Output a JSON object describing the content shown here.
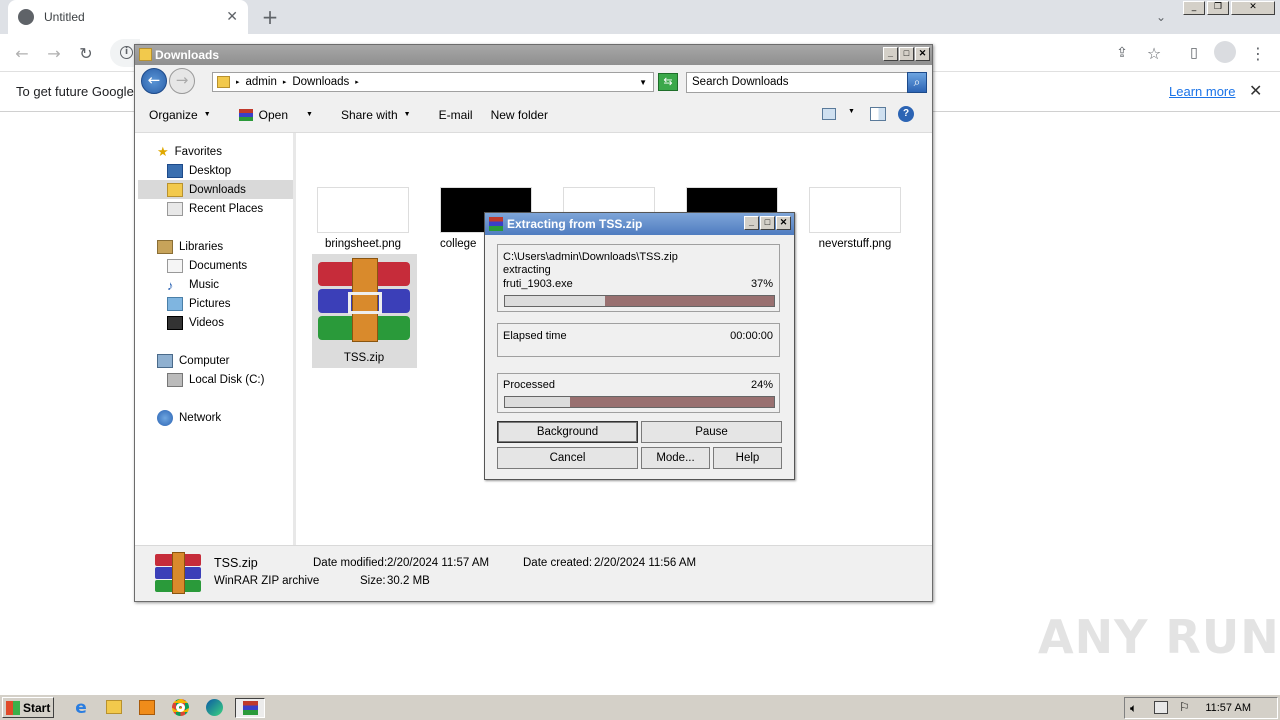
{
  "browser": {
    "tab_title": "Untitled",
    "new_tab": "+",
    "infobar_text": "To get future Google",
    "learn_more": "Learn more",
    "info_icon": "i"
  },
  "explorer": {
    "title": "Downloads",
    "breadcrumb": [
      "admin",
      "Downloads"
    ],
    "search_placeholder": "Search Downloads",
    "commands": [
      "Organize",
      "Open",
      "Share with",
      "E-mail",
      "New folder"
    ],
    "nav": {
      "favorites": "Favorites",
      "favorites_items": [
        "Desktop",
        "Downloads",
        "Recent Places"
      ],
      "libraries": "Libraries",
      "libraries_items": [
        "Documents",
        "Music",
        "Pictures",
        "Videos"
      ],
      "computer": "Computer",
      "computer_items": [
        "Local Disk (C:)"
      ],
      "network": "Network"
    },
    "files": [
      "bringsheet.png",
      "college",
      "neverstuff.png",
      "TSS.zip"
    ],
    "details": {
      "name": "TSS.zip",
      "type": "WinRAR ZIP archive",
      "modified_label": "Date modified:",
      "modified": "2/20/2024 11:57 AM",
      "created_label": "Date created:",
      "created": "2/20/2024 11:56 AM",
      "size_label": "Size:",
      "size": "30.2 MB"
    }
  },
  "extract": {
    "title": "Extracting from TSS.zip",
    "path": "C:\\Users\\admin\\Downloads\\TSS.zip",
    "action": "extracting",
    "file": "fruti_1903.exe",
    "file_percent": "37%",
    "file_progress": 0.37,
    "elapsed_label": "Elapsed time",
    "elapsed": "00:00:00",
    "processed_label": "Processed",
    "processed_percent": "24%",
    "processed_progress": 0.24,
    "buttons": [
      "Background",
      "Pause",
      "Cancel",
      "Mode...",
      "Help"
    ]
  },
  "taskbar": {
    "start": "Start",
    "clock": "11:57 AM"
  },
  "watermark": "ANY RUN"
}
